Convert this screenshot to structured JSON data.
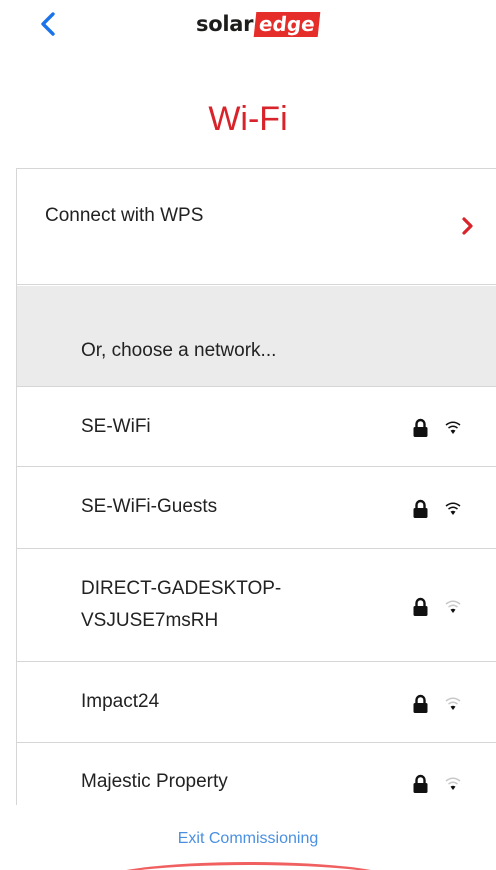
{
  "header": {
    "back_icon": "chevron-left-icon",
    "logo_part1": "solar",
    "logo_part2": "edge",
    "accent_color": "#e52d2a"
  },
  "page": {
    "title": "Wi-Fi"
  },
  "wps": {
    "label": "Connect with WPS",
    "chevron_icon": "chevron-right-icon"
  },
  "networks_header": "Or, choose a network...",
  "networks": [
    {
      "name": "SE-WiFi",
      "secured": true,
      "signal": "strong"
    },
    {
      "name": "SE-WiFi-Guests",
      "secured": true,
      "signal": "strong"
    },
    {
      "name": "DIRECT-GADESKTOP-VSJUSE7msRH",
      "secured": true,
      "signal": "weak"
    },
    {
      "name": "Impact24",
      "secured": true,
      "signal": "weak"
    },
    {
      "name": "Majestic Property",
      "secured": true,
      "signal": "weak"
    }
  ],
  "footer": {
    "exit_label": "Exit Commissioning",
    "link_color": "#4a90e2"
  }
}
